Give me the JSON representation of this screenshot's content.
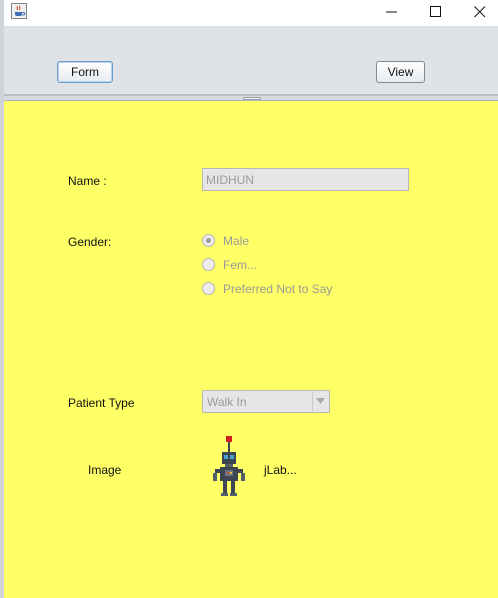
{
  "window": {
    "app_icon": "java-cup-icon",
    "controls": {
      "minimize": "minimize-icon",
      "maximize": "maximize-icon",
      "close": "close-icon"
    }
  },
  "toolbar": {
    "form_label": "Form",
    "view_label": "View"
  },
  "form": {
    "background": "#ffff66",
    "name_label": "Name :",
    "name_value": "MIDHUN",
    "gender_label": "Gender:",
    "gender_options": [
      "Male",
      "Fem...",
      "Preferred Not to Say"
    ],
    "gender_selected": "Male",
    "patient_type_label": "Patient Type",
    "patient_type_value": "Walk In",
    "image_label": "Image",
    "image_icon": "robot-icon",
    "image_caption": "jLab..."
  }
}
